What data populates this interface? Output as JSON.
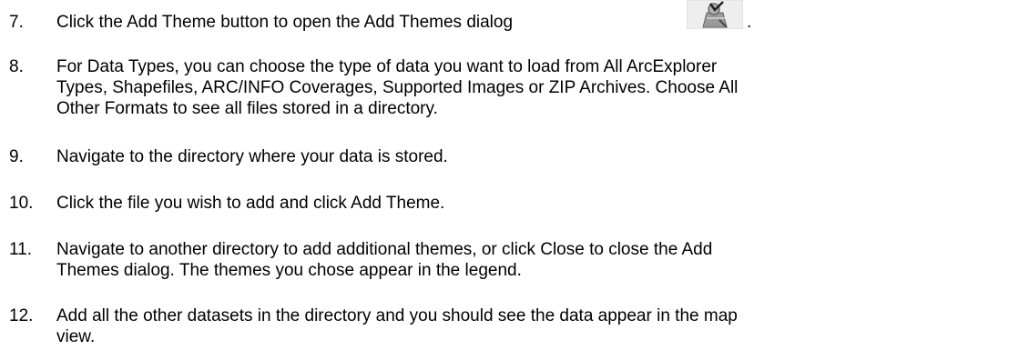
{
  "steps": [
    {
      "number": "7.",
      "lines": [
        "Click the Add Theme button to open the Add Themes dialog"
      ],
      "icon": "add-theme-icon",
      "trailing": "."
    },
    {
      "number": "8.",
      "lines": [
        "For Data Types, you can choose the type of data you want to load from All ArcExplorer",
        "Types, Shapefiles, ARC/INFO Coverages, Supported Images or ZIP Archives.  Choose All",
        "Other Formats to see all files stored in a directory."
      ]
    },
    {
      "number": "9.",
      "lines": [
        "Navigate to the directory where your data is stored."
      ]
    },
    {
      "number": "10.",
      "lines": [
        "Click the file you wish to add and click Add Theme."
      ]
    },
    {
      "number": "11.",
      "lines": [
        "Navigate to another directory to add additional themes, or click Close to close the Add",
        "Themes dialog.  The themes you chose appear in the legend."
      ]
    },
    {
      "number": "12.",
      "lines": [
        "Add all the other datasets in the directory and you should see the data appear in the map",
        "view."
      ]
    }
  ]
}
